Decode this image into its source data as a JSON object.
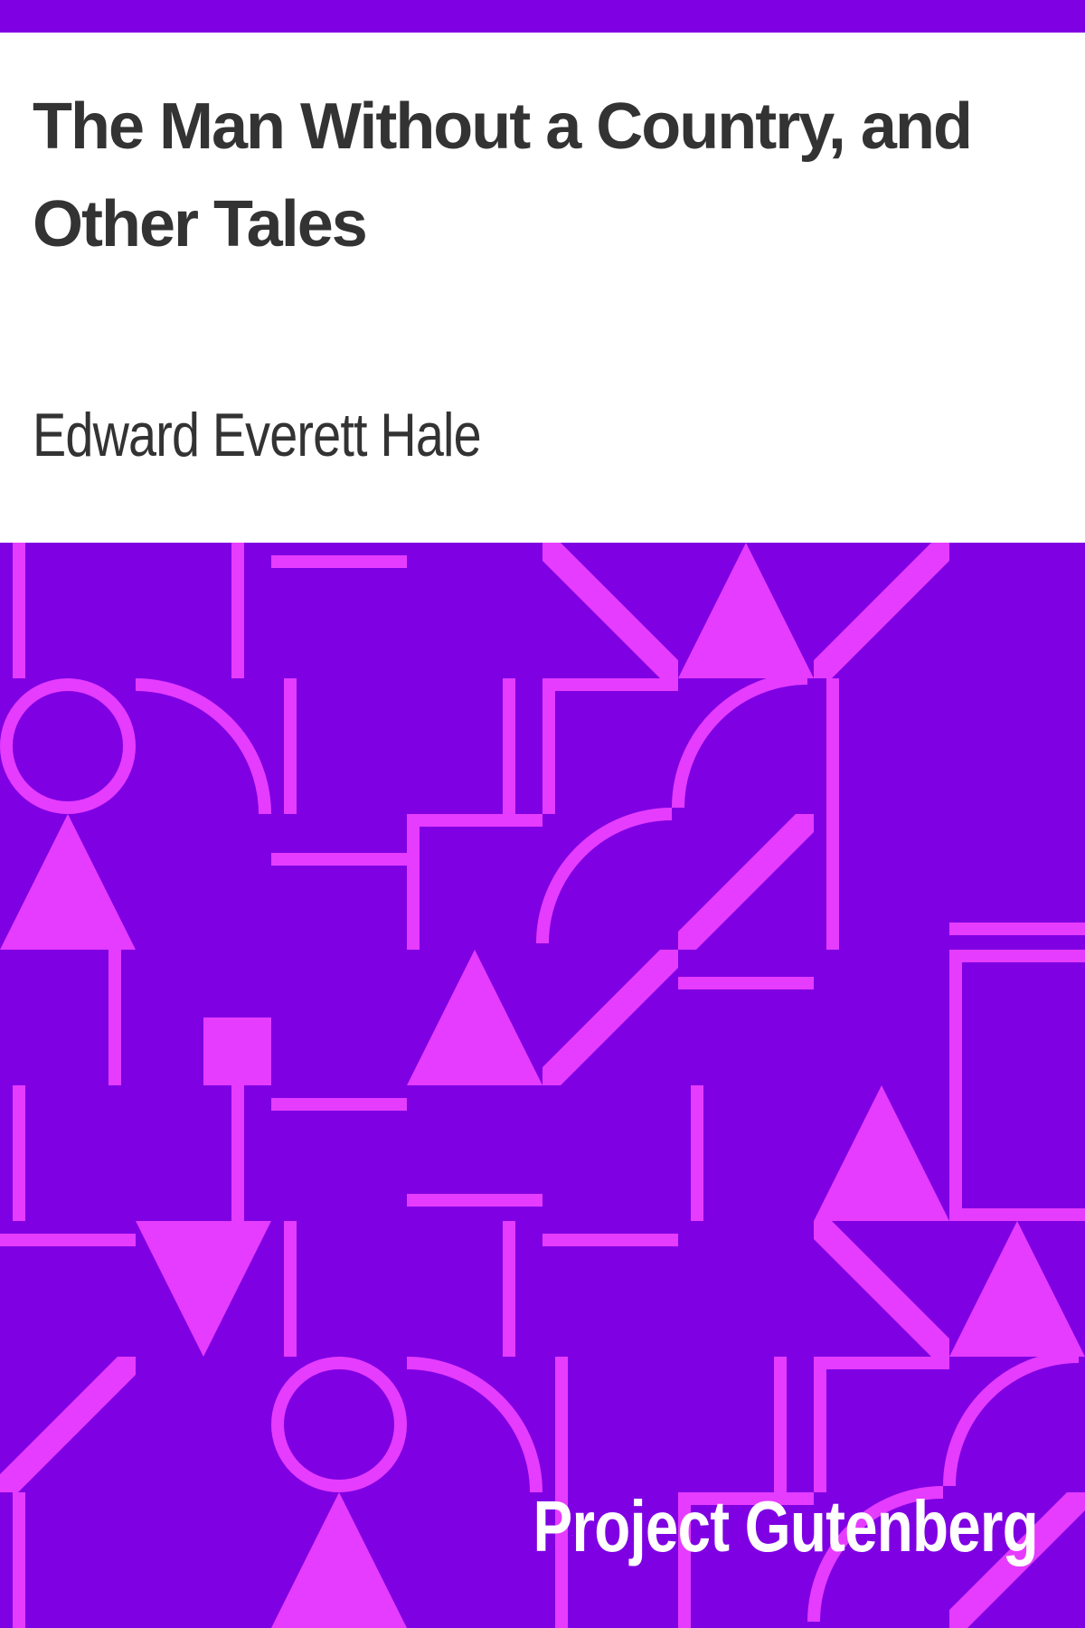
{
  "book": {
    "title": "The Man Without a Country, and Other Tales",
    "author": "Edward Everett Hale"
  },
  "brand": {
    "name": "Project Gutenberg"
  },
  "colors": {
    "background": "#7f00e3",
    "pattern": "#e63cff",
    "header": "#ffffff",
    "text": "#333333"
  }
}
